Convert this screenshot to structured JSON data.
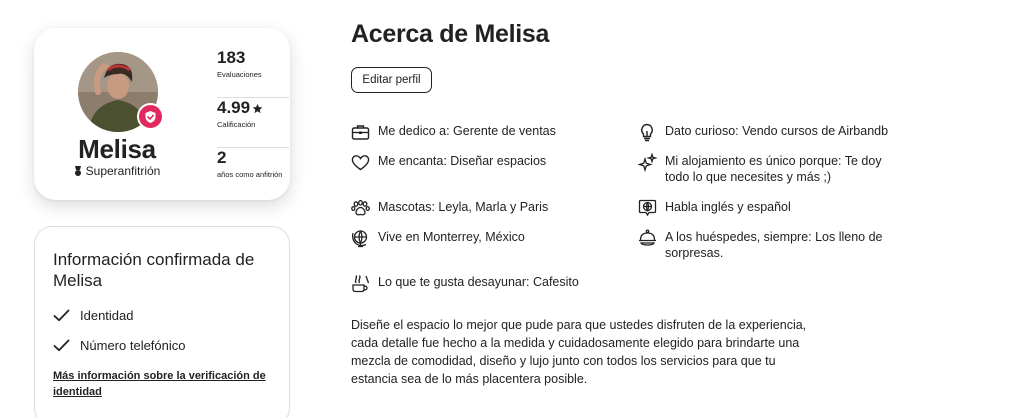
{
  "profile": {
    "name": "Melisa",
    "superhost_label": "Superanfitrión",
    "stats": [
      {
        "value": "183",
        "label": "Evaluaciones"
      },
      {
        "value": "4.99",
        "label": "Calificación"
      },
      {
        "value": "2",
        "label": "años como anfitrión"
      }
    ]
  },
  "confirmed": {
    "title": "Información confirmada de Melisa",
    "items": [
      "Identidad",
      "Número telefónico"
    ],
    "link": "Más información sobre la verificación de identidad"
  },
  "about": {
    "title": "Acerca de Melisa",
    "edit_button": "Editar perfil",
    "facts": [
      {
        "icon": "briefcase-icon",
        "text": "Me dedico a: Gerente de ventas"
      },
      {
        "icon": "lightbulb-icon",
        "text": "Dato curioso: Vendo cursos de Airbandb"
      },
      {
        "icon": "heart-icon",
        "text": "Me encanta: Diseñar espacios"
      },
      {
        "icon": "sparkles-icon",
        "text": "Mi alojamiento es único porque: Te doy todo lo que necesites y más ;)"
      },
      {
        "icon": "paw-icon",
        "text": "Mascotas: Leyla, Marla y Paris"
      },
      {
        "icon": "speech-globe-icon",
        "text": "Habla inglés y español"
      },
      {
        "icon": "globe-pin-icon",
        "text": "Vive en Monterrey, México"
      },
      {
        "icon": "cloche-icon",
        "text": "A los huéspedes, siempre: Los lleno de sorpresas."
      },
      {
        "icon": "breakfast-icon",
        "text": "Lo que te gusta desayunar: Cafesito"
      }
    ],
    "bio": "Diseñe el espacio lo mejor que pude para que ustedes disfruten de la experiencia, cada detalle fue hecho a la medida  y cuidadosamente elegido para brindarte una mezcla de comodidad, diseño y  lujo junto con todos los servicios para que tu estancia sea de lo más placentera posible."
  },
  "colors": {
    "accent": "#e1295f",
    "text": "#222222",
    "border": "#dddddd"
  }
}
